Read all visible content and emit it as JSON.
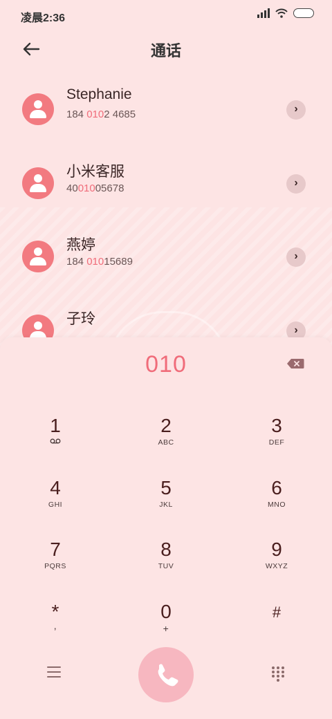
{
  "status_bar": {
    "time": "凌晨2:36"
  },
  "header": {
    "back_icon": "arrow-left-icon",
    "title": "通话"
  },
  "contacts": [
    {
      "name": "Stephanie",
      "number_pre": "184 ",
      "number_hl": "010",
      "number_post": "2 4685"
    },
    {
      "name": "小米客服",
      "number_pre": "40",
      "number_hl": "010",
      "number_post": "05678"
    },
    {
      "name": "燕婷",
      "number_pre": "184 ",
      "number_hl": "010",
      "number_post": "15689"
    },
    {
      "name": "子玲",
      "number_pre": "",
      "number_hl": "",
      "number_post": ""
    }
  ],
  "dialpad": {
    "input": "010",
    "keys": [
      {
        "digit": "1",
        "letters": ""
      },
      {
        "digit": "2",
        "letters": "ABC"
      },
      {
        "digit": "3",
        "letters": "DEF"
      },
      {
        "digit": "4",
        "letters": "GHI"
      },
      {
        "digit": "5",
        "letters": "JKL"
      },
      {
        "digit": "6",
        "letters": "MNO"
      },
      {
        "digit": "7",
        "letters": "PQRS"
      },
      {
        "digit": "8",
        "letters": "TUV"
      },
      {
        "digit": "9",
        "letters": "WXYZ"
      },
      {
        "digit": "*",
        "letters": ","
      },
      {
        "digit": "0",
        "letters": "+"
      },
      {
        "digit": "#",
        "letters": ""
      }
    ]
  },
  "colors": {
    "accent": "#f06c7a",
    "avatar": "#f27a80",
    "call_button": "#f7b7c0",
    "background": "#fde4e4"
  }
}
